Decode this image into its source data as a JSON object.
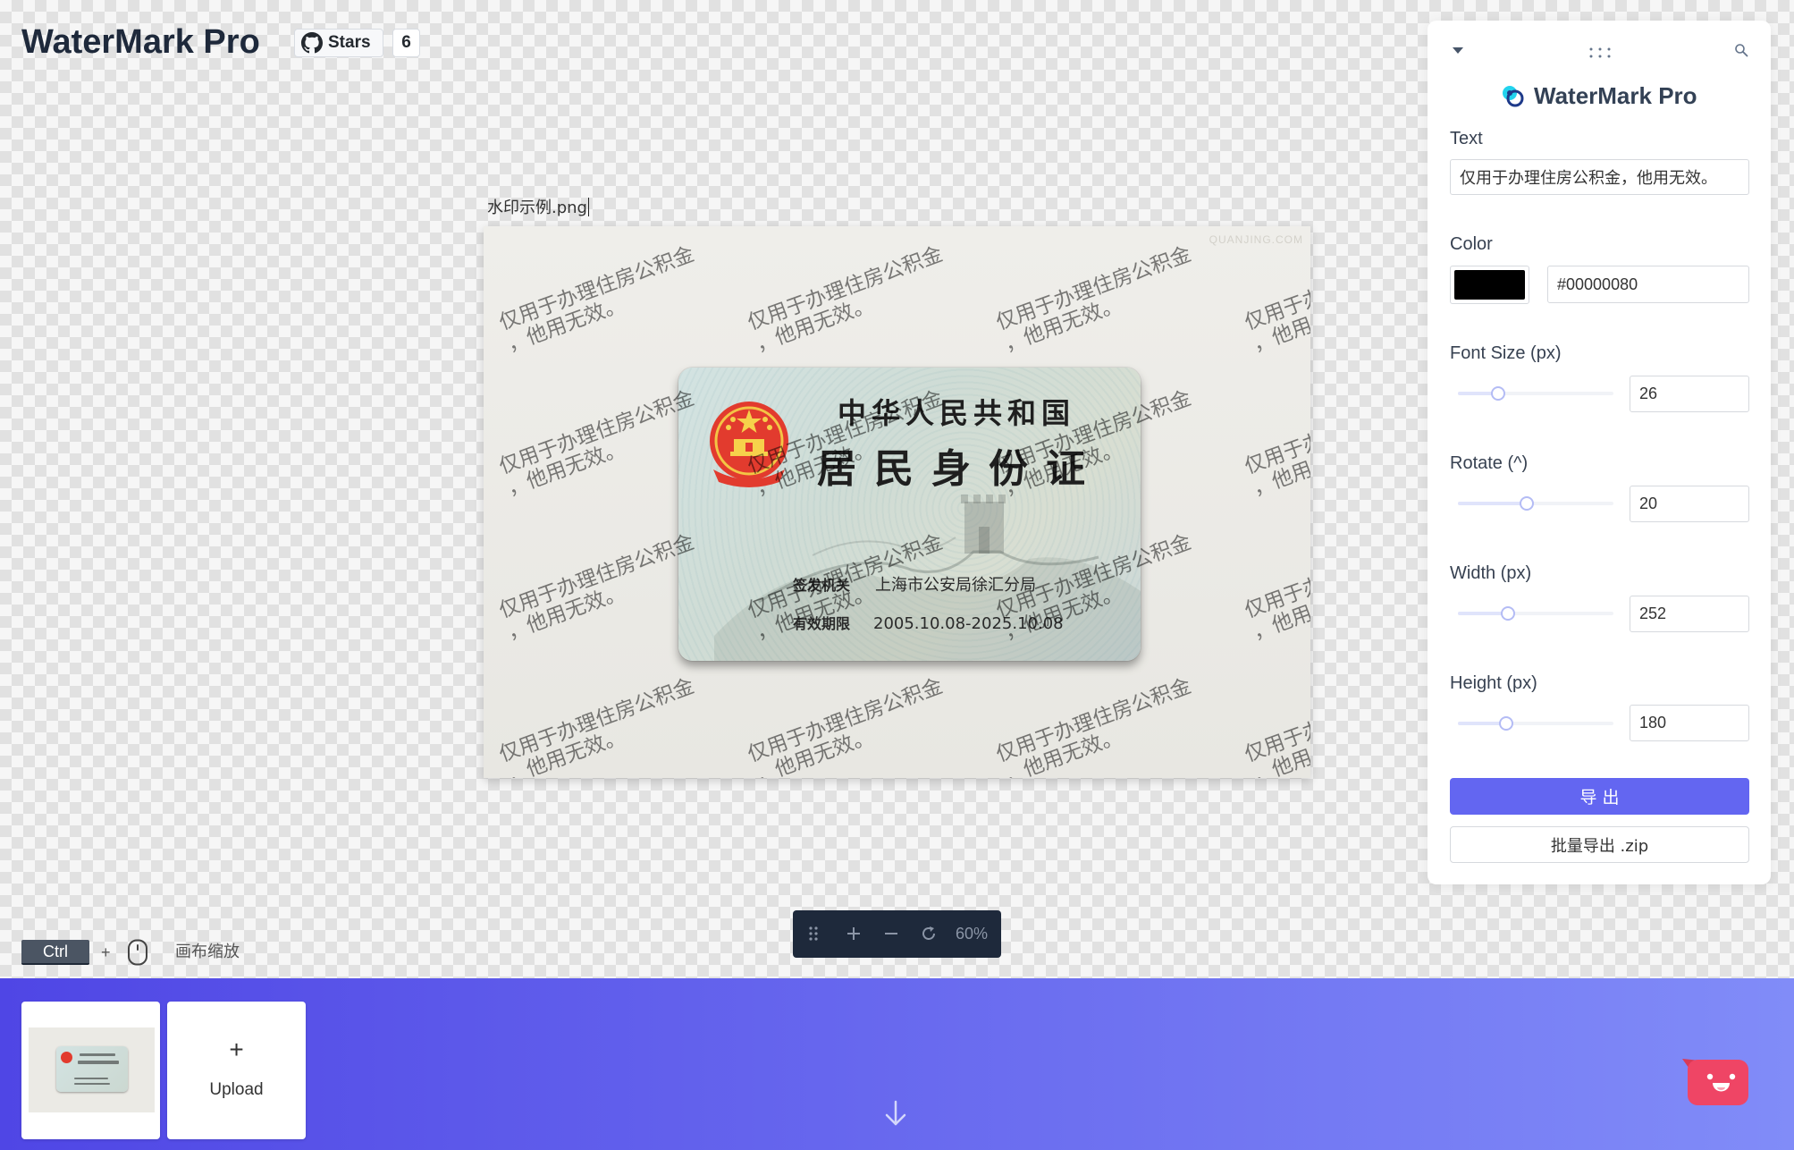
{
  "app": {
    "title": "WaterMark Pro"
  },
  "github": {
    "stars_label": "Stars",
    "stars_count": "6"
  },
  "canvas": {
    "file_name": "水印示例.png",
    "photo": {
      "site_mark": "QUANJING.COM",
      "id_card": {
        "country": "中华人民共和国",
        "title": "居民身份证",
        "issuer_label": "签发机关",
        "issuer": "上海市公安局徐汇分局",
        "validity_label": "有效期限",
        "validity": "2005.10.08-2025.10.08"
      }
    }
  },
  "panel": {
    "title": "WaterMark Pro",
    "text": {
      "label": "Text",
      "value": "仅用于办理住房公积金，他用无效。"
    },
    "color": {
      "label": "Color",
      "value": "#00000080",
      "swatch": "#000000"
    },
    "font_size": {
      "label": "Font Size (px)",
      "value": "26",
      "slider": 0.26
    },
    "rotate": {
      "label": "Rotate (^)",
      "value": "20",
      "slider": 0.44
    },
    "width": {
      "label": "Width (px)",
      "value": "252",
      "slider": 0.32
    },
    "height": {
      "label": "Height (px)",
      "value": "180",
      "slider": 0.31
    },
    "export_label": "导 出",
    "batch_export_label": "批量导出 .zip"
  },
  "shortcut_hint": {
    "key": "Ctrl",
    "plus": "+",
    "action": "画布缩放"
  },
  "zoom_toolbar": {
    "level": "60%"
  },
  "tray": {
    "upload_plus": "+",
    "upload_label": "Upload"
  },
  "icons": {
    "github": "github-icon",
    "panel_collapse": "caret-down-icon",
    "panel_drag": "drag-dots-icon",
    "panel_search": "search-icon",
    "brand": "logo-icon",
    "mouse": "mouse-icon",
    "zoom_drag": "drag-handle-icon",
    "zoom_in": "plus-icon",
    "zoom_out": "minus-icon",
    "zoom_reset": "rotate-icon",
    "scroll_down": "arrow-down-icon",
    "assistant": "mascot-icon"
  },
  "colors": {
    "accent": "#6366f1",
    "title": "#1e293b",
    "toolbar_bg": "#1e293b",
    "tray_start": "#4f46e5",
    "tray_end": "#818cf8",
    "mascot": "#ef4565"
  }
}
